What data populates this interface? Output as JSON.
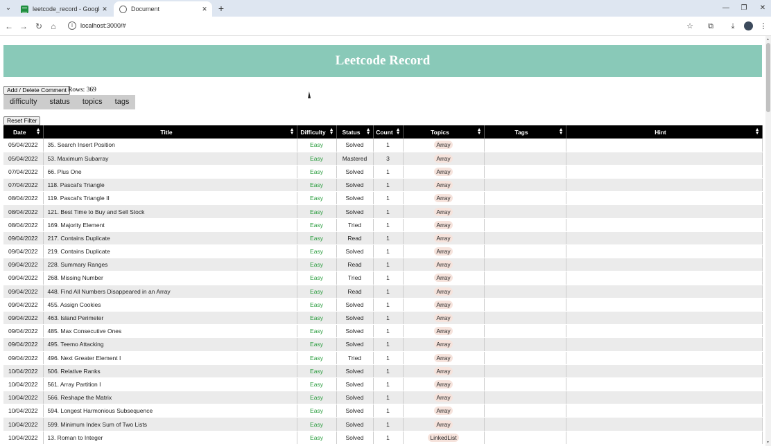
{
  "browser": {
    "tabs": [
      {
        "label": "leetcode_record - Google Sheets",
        "active": false,
        "icon": "sheets-icon"
      },
      {
        "label": "Document",
        "active": true,
        "icon": "globe-icon"
      }
    ],
    "url": "localhost:3000/#"
  },
  "page": {
    "title": "Leetcode Record",
    "comment_button": "Add / Delete Comment",
    "rows_label": "Rows: 369",
    "filters": [
      "difficulty",
      "status",
      "topics",
      "tags"
    ],
    "reset_button": "Reset Filter",
    "accent_color": "#89c9b8"
  },
  "table": {
    "columns": [
      "Date",
      "Title",
      "Difficulty",
      "Status",
      "Count",
      "Topics",
      "Tags",
      "Hint"
    ],
    "rows": [
      [
        "05/04/2022",
        "35. Search Insert Position",
        "Easy",
        "Solved",
        "1",
        "Array",
        "",
        ""
      ],
      [
        "05/04/2022",
        "53. Maximum Subarray",
        "Easy",
        "Mastered",
        "3",
        "Array",
        "",
        ""
      ],
      [
        "07/04/2022",
        "66. Plus One",
        "Easy",
        "Solved",
        "1",
        "Array",
        "",
        ""
      ],
      [
        "07/04/2022",
        "118. Pascal's Triangle",
        "Easy",
        "Solved",
        "1",
        "Array",
        "",
        ""
      ],
      [
        "08/04/2022",
        "119. Pascal's Triangle II",
        "Easy",
        "Solved",
        "1",
        "Array",
        "",
        ""
      ],
      [
        "08/04/2022",
        "121. Best Time to Buy and Sell Stock",
        "Easy",
        "Solved",
        "1",
        "Array",
        "",
        ""
      ],
      [
        "08/04/2022",
        "169. Majority Element",
        "Easy",
        "Tried",
        "1",
        "Array",
        "",
        ""
      ],
      [
        "09/04/2022",
        "217. Contains Duplicate",
        "Easy",
        "Read",
        "1",
        "Array",
        "",
        ""
      ],
      [
        "09/04/2022",
        "219. Contains Duplicate",
        "Easy",
        "Solved",
        "1",
        "Array",
        "",
        ""
      ],
      [
        "09/04/2022",
        "228. Summary Ranges",
        "Easy",
        "Read",
        "1",
        "Array",
        "",
        ""
      ],
      [
        "09/04/2022",
        "268. Missing Number",
        "Easy",
        "Tried",
        "1",
        "Array",
        "",
        ""
      ],
      [
        "09/04/2022",
        "448. Find All Numbers Disappeared in an Array",
        "Easy",
        "Read",
        "1",
        "Array",
        "",
        ""
      ],
      [
        "09/04/2022",
        "455.  Assign Cookies",
        "Easy",
        "Solved",
        "1",
        "Array",
        "",
        ""
      ],
      [
        "09/04/2022",
        "463. Island Perimeter",
        "Easy",
        "Solved",
        "1",
        "Array",
        "",
        ""
      ],
      [
        "09/04/2022",
        "485. Max Consecutive Ones",
        "Easy",
        "Solved",
        "1",
        "Array",
        "",
        ""
      ],
      [
        "09/04/2022",
        "495. Teemo Attacking",
        "Easy",
        "Solved",
        "1",
        "Array",
        "",
        ""
      ],
      [
        "09/04/2022",
        "496. Next Greater Element I",
        "Easy",
        "Tried",
        "1",
        "Array",
        "",
        ""
      ],
      [
        "10/04/2022",
        "506. Relative Ranks",
        "Easy",
        "Solved",
        "1",
        "Array",
        "",
        ""
      ],
      [
        "10/04/2022",
        "561. Array Partition I",
        "Easy",
        "Solved",
        "1",
        "Array",
        "",
        ""
      ],
      [
        "10/04/2022",
        "566. Reshape the Matrix",
        "Easy",
        "Solved",
        "1",
        "Array",
        "",
        ""
      ],
      [
        "10/04/2022",
        "594. Longest Harmonious Subsequence",
        "Easy",
        "Solved",
        "1",
        "Array",
        "",
        ""
      ],
      [
        "10/04/2022",
        "599. Minimum Index Sum of Two Lists",
        "Easy",
        "Solved",
        "1",
        "Array",
        "",
        ""
      ],
      [
        "10/04/2022",
        "13. Roman to Integer",
        "Easy",
        "Solved",
        "1",
        "LinkedList",
        "",
        ""
      ]
    ]
  }
}
